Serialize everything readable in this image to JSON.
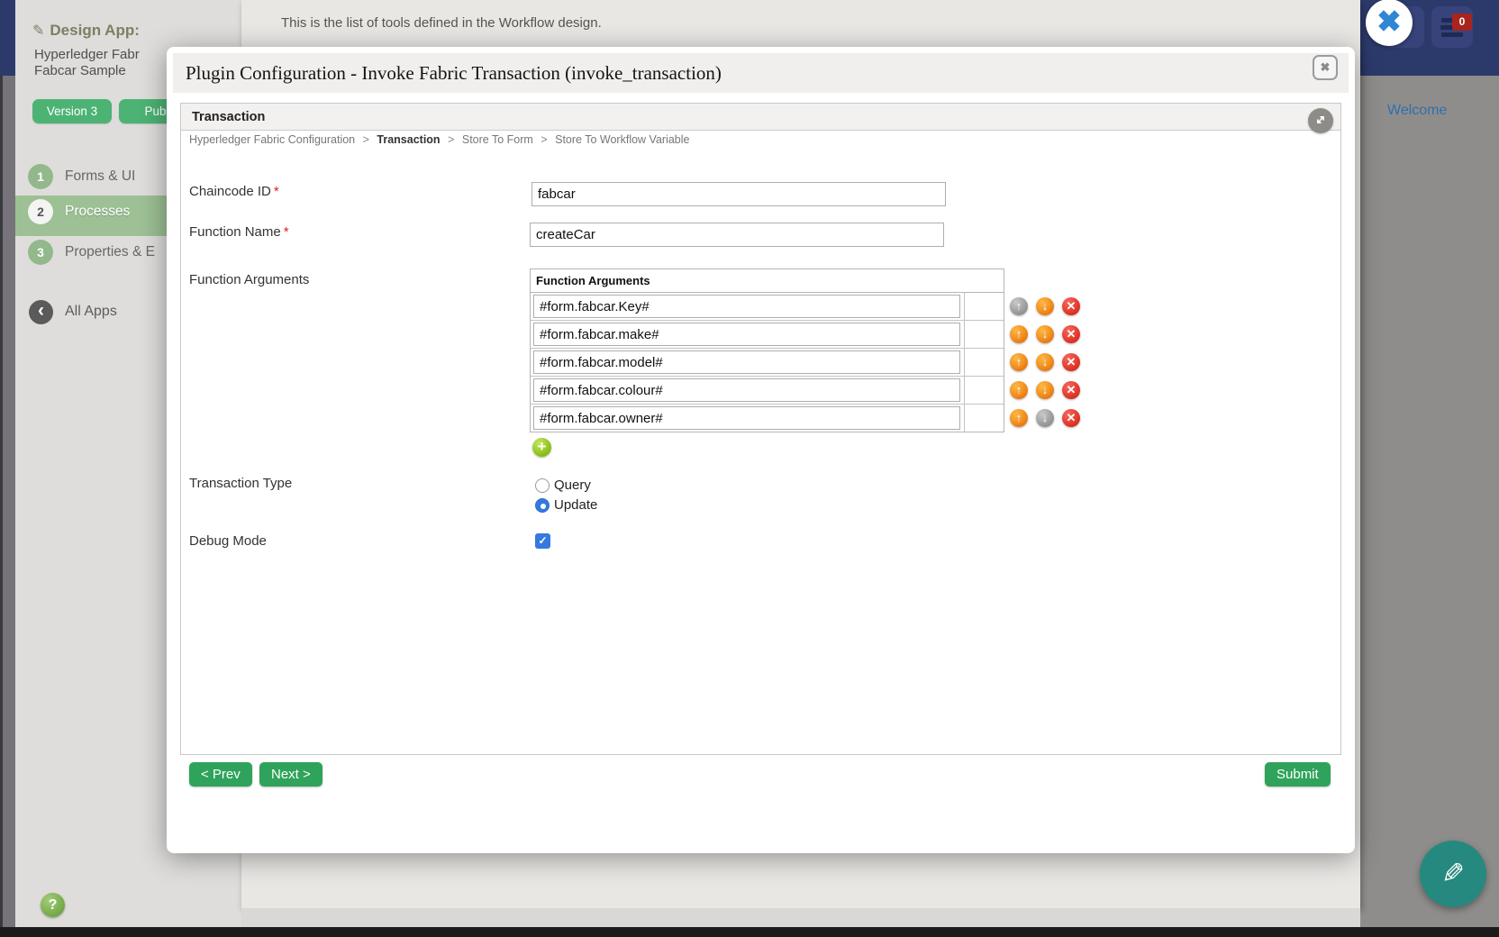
{
  "header": {
    "top_message": "This is the list of tools defined in the Workflow design.",
    "welcome_link": "Welcome",
    "notification_count": "0"
  },
  "sidebar": {
    "section_title": "Design App:",
    "app_name_line1": "Hyperledger Fabr",
    "app_name_line2": "Fabcar Sample",
    "version_badge": "Version 3",
    "published_badge": "Publ",
    "items": [
      {
        "number": "1",
        "label": "Forms & UI",
        "active": false
      },
      {
        "number": "2",
        "label": "Processes",
        "active": true
      },
      {
        "number": "3",
        "label": "Properties & E",
        "active": false
      }
    ],
    "all_apps_label": "All Apps"
  },
  "modal": {
    "title": "Plugin Configuration - Invoke Fabric Transaction (invoke_transaction)",
    "section_title": "Transaction",
    "breadcrumb": {
      "separator": ">",
      "segments": [
        {
          "label": "Hyperledger Fabric Configuration",
          "bold": false
        },
        {
          "label": "Transaction",
          "bold": true
        },
        {
          "label": "Store To Form",
          "bold": false
        },
        {
          "label": "Store To Workflow Variable",
          "bold": false
        }
      ]
    },
    "required_marker": "*",
    "fields": {
      "chaincode_id": {
        "label": "Chaincode ID",
        "required": true,
        "value": "fabcar"
      },
      "function_name": {
        "label": "Function Name",
        "required": true,
        "value": "createCar"
      },
      "function_arguments": {
        "label": "Function Arguments",
        "table_header": "Function Arguments",
        "rows": [
          {
            "value": "#form.fabcar.Key#",
            "up_disabled": true,
            "down_disabled": false
          },
          {
            "value": "#form.fabcar.make#",
            "up_disabled": false,
            "down_disabled": false
          },
          {
            "value": "#form.fabcar.model#",
            "up_disabled": false,
            "down_disabled": false
          },
          {
            "value": "#form.fabcar.colour#",
            "up_disabled": false,
            "down_disabled": false
          },
          {
            "value": "#form.fabcar.owner#",
            "up_disabled": false,
            "down_disabled": true
          }
        ]
      },
      "transaction_type": {
        "label": "Transaction Type",
        "options": [
          {
            "label": "Query",
            "selected": false
          },
          {
            "label": "Update",
            "selected": true
          }
        ]
      },
      "debug_mode": {
        "label": "Debug Mode",
        "checked": true
      }
    },
    "footer": {
      "prev": "< Prev",
      "next": "Next >",
      "submit": "Submit"
    }
  },
  "icons": {
    "up_arrow": "↑",
    "down_arrow": "↓",
    "delete_x": "✕",
    "add_plus": "+",
    "close_x": "✖",
    "blue_close_x": "✖",
    "pencil": "✎",
    "home": "⌂",
    "back_chevron": "‹",
    "help_question": "?",
    "checkmark": "✓"
  },
  "colors": {
    "accent_green": "#2fa35b",
    "badge_green": "#4cb374",
    "sidebar_active_green": "#9dc094",
    "navy": "#2c3a6b",
    "radio_blue": "#3579de",
    "close_x_blue": "#2e86d4",
    "fab_teal": "#26897f",
    "delete_red": "#e2372a",
    "arrow_orange": "#f08c1e",
    "notification_red": "#a8241e"
  }
}
